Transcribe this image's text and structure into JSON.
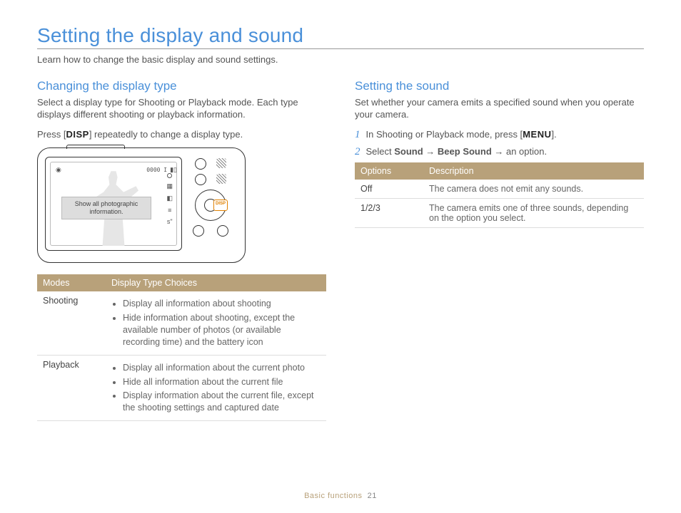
{
  "title": "Setting the display and sound",
  "intro": "Learn how to change the basic display and sound settings.",
  "left": {
    "heading": "Changing the display type",
    "desc": "Select a display type for Shooting or Playback mode. Each type displays different shooting or playback information.",
    "press_pre": "Press [",
    "press_btn": "DISP",
    "press_post": "] repeatedly to change a display type.",
    "callout": "Show all photographic information.",
    "dpad_hl": "DISP",
    "table": {
      "h1": "Modes",
      "h2": "Display Type Choices",
      "rows": [
        {
          "mode": "Shooting",
          "items": [
            "Display all information about shooting",
            "Hide information about shooting, except the available number of photos (or available recording time) and the battery icon"
          ]
        },
        {
          "mode": "Playback",
          "items": [
            "Display all information about the current photo",
            "Hide all information about the current file",
            "Display information about the current file, except the shooting settings and captured date"
          ]
        }
      ]
    }
  },
  "right": {
    "heading": "Setting the sound",
    "desc": "Set whether your camera emits a specified sound when you operate your camera.",
    "steps": [
      {
        "n": "1",
        "pre": "In Shooting or Playback mode, press [",
        "btn": "MENU",
        "post": "]."
      },
      {
        "n": "2",
        "text_pre": "Select ",
        "b1": "Sound",
        "arrow": " → ",
        "b2": "Beep Sound",
        "text_post": " → an option."
      }
    ],
    "table": {
      "h1": "Options",
      "h2": "Description",
      "rows": [
        {
          "opt": "Off",
          "desc": "The camera does not emit any sounds."
        },
        {
          "opt": "1/2/3",
          "desc": "The camera emits one of three sounds, depending on the option you select."
        }
      ]
    }
  },
  "footer": {
    "section": "Basic functions",
    "page": "21"
  }
}
